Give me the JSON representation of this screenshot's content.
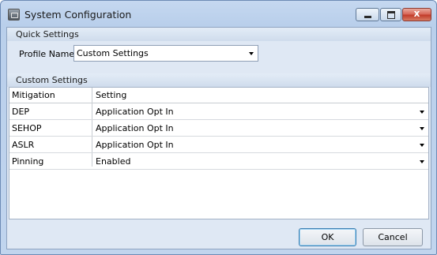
{
  "window": {
    "title": "System Configuration",
    "close_glyph": "x"
  },
  "quick_settings": {
    "heading": "Quick Settings",
    "profile_label": "Profile Name",
    "profile_value": "Custom Settings"
  },
  "custom_settings": {
    "heading": "Custom Settings",
    "columns": [
      "Mitigation",
      "Setting"
    ],
    "rows": [
      {
        "mitigation": "DEP",
        "setting": "Application Opt In"
      },
      {
        "mitigation": "SEHOP",
        "setting": "Application Opt In"
      },
      {
        "mitigation": "ASLR",
        "setting": "Application Opt In"
      },
      {
        "mitigation": "Pinning",
        "setting": "Enabled"
      }
    ]
  },
  "buttons": {
    "ok": "OK",
    "cancel": "Cancel"
  },
  "icons": {
    "app": "app-window-icon",
    "minimize": "minimize-icon",
    "maximize": "maximize-icon",
    "close": "close-icon",
    "dropdown": "chevron-down-icon"
  }
}
